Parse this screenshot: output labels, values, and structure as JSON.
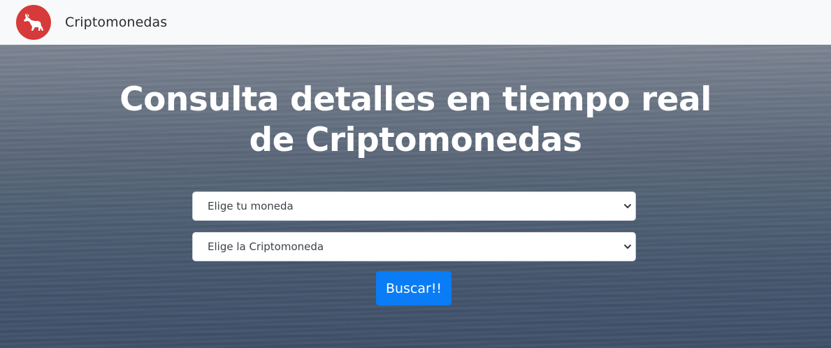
{
  "navbar": {
    "brand": "Criptomonedas",
    "logo_icon": "fox-icon",
    "logo_color": "#d63a3a"
  },
  "hero": {
    "title_line1": "Consulta detalles en tiempo real",
    "title_line2": "de Criptomonedas"
  },
  "form": {
    "currency_select": {
      "selected": "Elige tu moneda",
      "icon": "chevron-down-icon"
    },
    "crypto_select": {
      "selected": "Elige la Criptomoneda",
      "icon": "chevron-down-icon"
    },
    "submit_label": "Buscar!!",
    "submit_color": "#0a7cf5"
  }
}
